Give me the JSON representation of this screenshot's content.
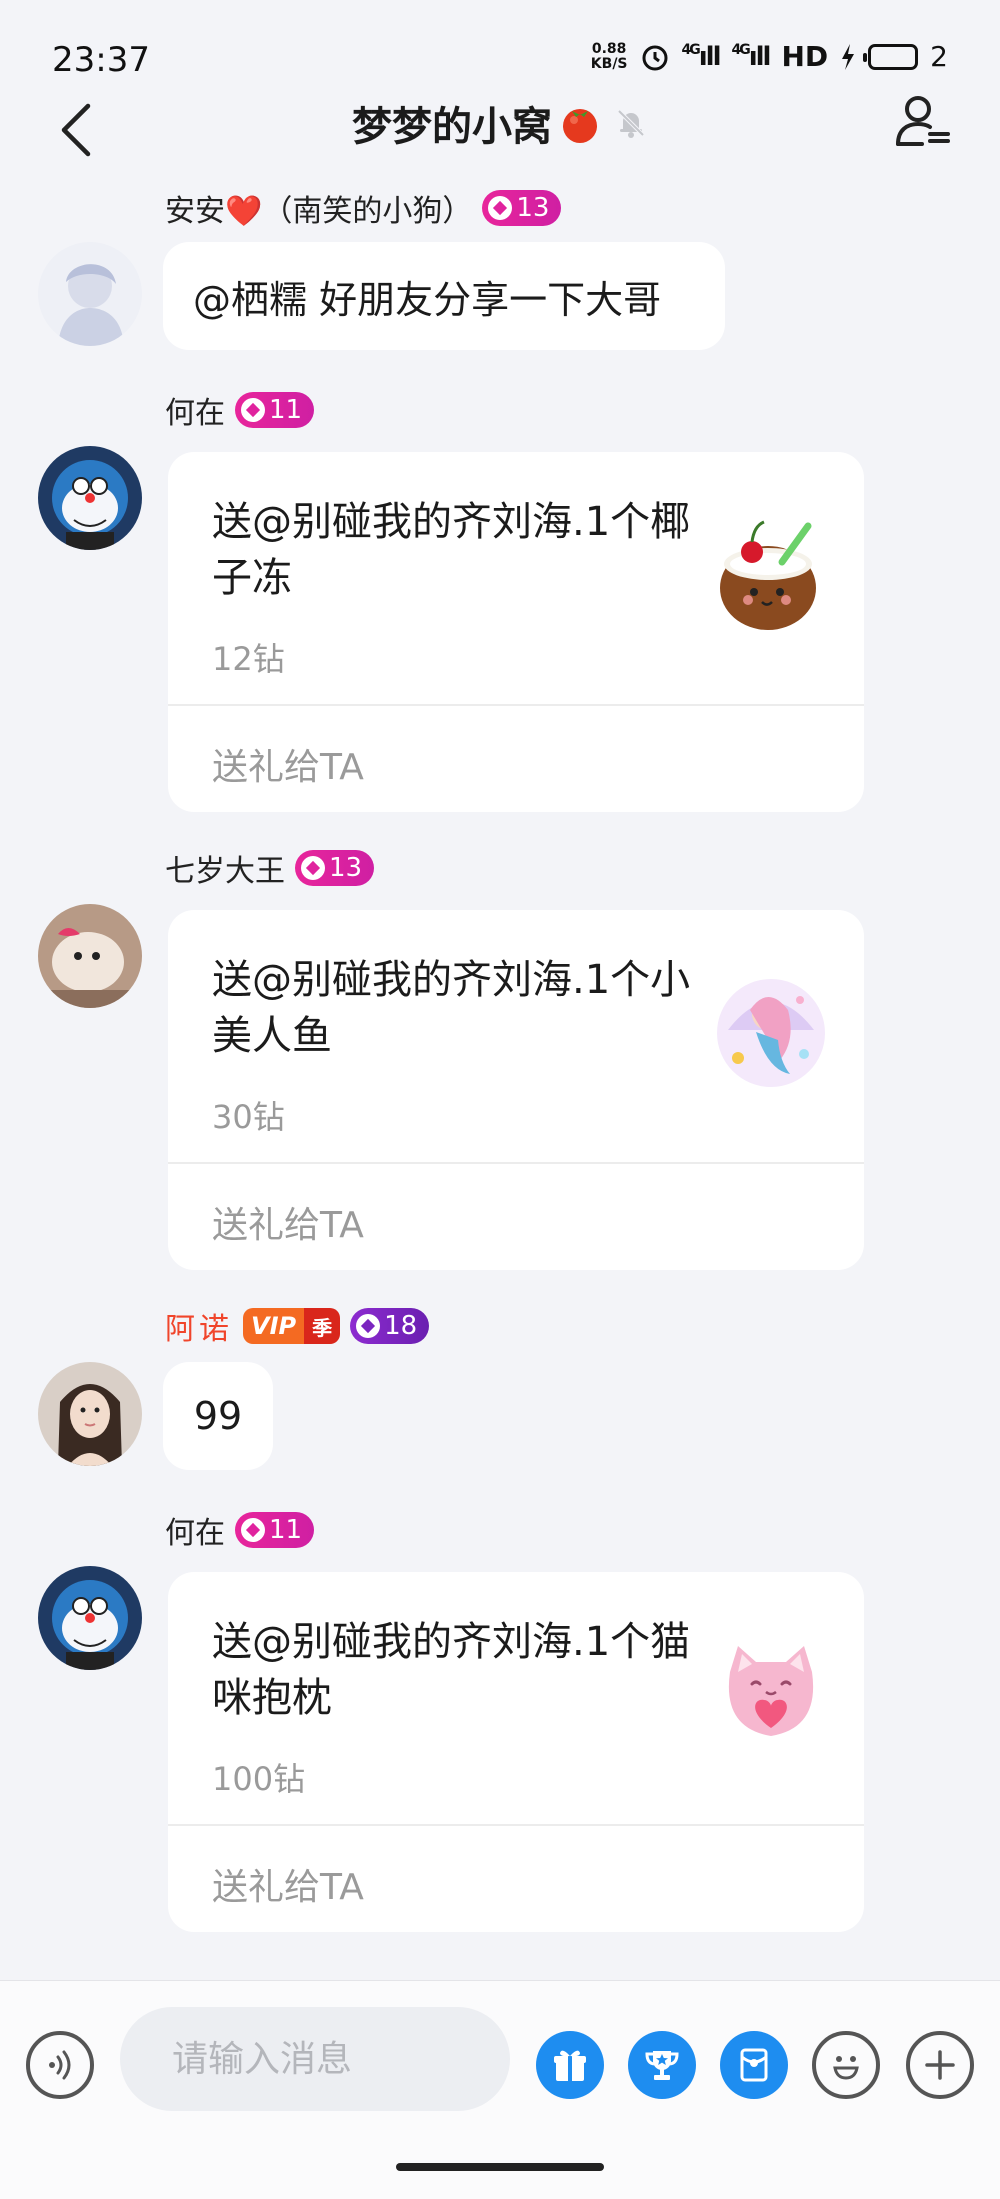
{
  "status_bar": {
    "time": "23:37",
    "net_speed_value": "0.88",
    "net_speed_unit": "KB/S",
    "signal1": "4G",
    "signal2": "4G",
    "hd": "HD",
    "battery": "2"
  },
  "header": {
    "title": "梦梦的小窝"
  },
  "messages": [
    {
      "sender": "安安❤️（南笑的小狗）",
      "level": "13",
      "text": "@栖糯 好朋友分享一下大哥"
    },
    {
      "sender": "何在",
      "level": "11",
      "gift_text": "送@别碰我的齐刘海.1个椰子冻",
      "gift_price": "12钻",
      "send_label": "送礼给TA",
      "gift_icon": "coconut-jelly-icon"
    },
    {
      "sender": "七岁大王",
      "level": "13",
      "gift_text": "送@别碰我的齐刘海.1个小美人鱼",
      "gift_price": "30钻",
      "send_label": "送礼给TA",
      "gift_icon": "mermaid-icon"
    },
    {
      "sender": "阿诺",
      "vip": "VIP",
      "vip_season": "季",
      "level": "18",
      "text": "99"
    },
    {
      "sender": "何在",
      "level": "11",
      "gift_text": "送@别碰我的齐刘海.1个猫咪抱枕",
      "gift_price": "100钻",
      "send_label": "送礼给TA",
      "gift_icon": "cat-pillow-icon"
    }
  ],
  "input_bar": {
    "placeholder": "请输入消息",
    "icons": [
      "voice-icon",
      "gift-icon",
      "trophy-icon",
      "red-packet-icon",
      "emoji-icon",
      "plus-icon"
    ]
  },
  "colors": {
    "accent_blue": "#1e8df0",
    "badge_pink": "#e0239e",
    "badge_purple": "#7b25c0",
    "vip_name_red": "#f0452b"
  }
}
